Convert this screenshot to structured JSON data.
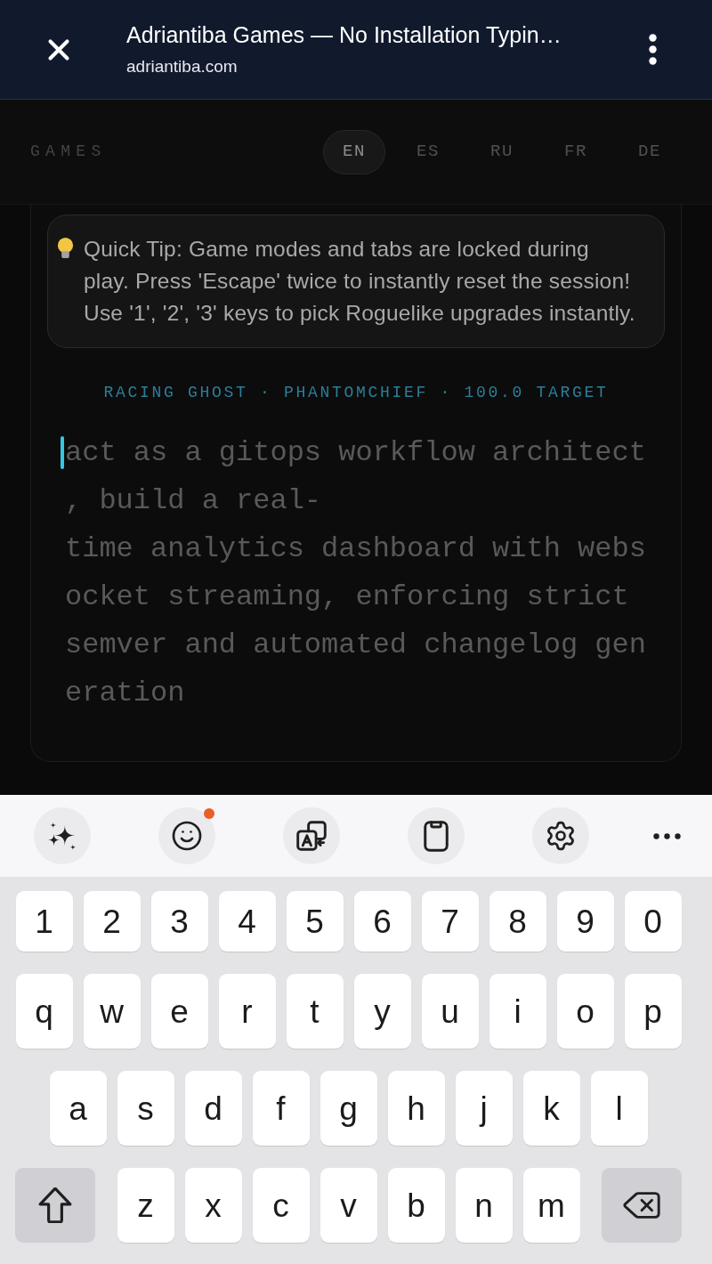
{
  "browser_bar": {
    "title": "Adriantiba Games — No Installation Typin…",
    "url": "adriantiba.com"
  },
  "site_nav": {
    "brand": "GAMES",
    "languages": [
      {
        "label": "EN",
        "selected": true
      },
      {
        "label": "ES",
        "selected": false
      },
      {
        "label": "RU",
        "selected": false
      },
      {
        "label": "FR",
        "selected": false
      },
      {
        "label": "DE",
        "selected": false
      }
    ]
  },
  "tip": {
    "text": "Quick Tip: Game modes and tabs are locked during play. Press 'Escape' twice to instantly reset the session! Use '1', '2', '3' keys to pick Roguelike upgrades instantly."
  },
  "race_info": {
    "text": "RACING GHOST · PHANTOMCHIEF · 100.0 TARGET"
  },
  "passage": {
    "lines": [
      "act as a gitops workflow architect",
      ", build a real-",
      "time analytics dashboard with webs",
      "ocket streaming, enforcing strict",
      "semver and automated changelog gen",
      "eration"
    ]
  },
  "keyboard": {
    "toolbar": [
      {
        "kind": "sparkle",
        "badge": false
      },
      {
        "kind": "emoji",
        "badge": true
      },
      {
        "kind": "translate",
        "badge": false
      },
      {
        "kind": "clipboard",
        "badge": false
      },
      {
        "kind": "settings",
        "badge": false
      },
      {
        "kind": "more",
        "badge": false
      }
    ],
    "rows": [
      {
        "kind": "number",
        "keys": [
          "1",
          "2",
          "3",
          "4",
          "5",
          "6",
          "7",
          "8",
          "9",
          "0"
        ]
      },
      {
        "kind": "letter",
        "keys": [
          "q",
          "w",
          "e",
          "r",
          "t",
          "y",
          "u",
          "i",
          "o",
          "p"
        ]
      },
      {
        "kind": "letter",
        "keys": [
          "a",
          "s",
          "d",
          "f",
          "g",
          "h",
          "j",
          "k",
          "l"
        ]
      },
      {
        "kind": "bottom",
        "keys": [
          "z",
          "x",
          "c",
          "v",
          "b",
          "n",
          "m"
        ]
      }
    ]
  }
}
